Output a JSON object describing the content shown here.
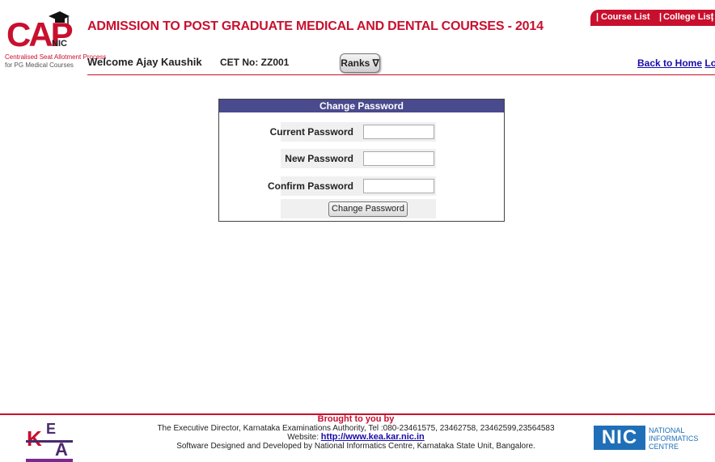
{
  "header": {
    "logo_text": "CAP",
    "logo_sub": "NIC",
    "logo_tagline_1": "Centralised Seat Allotment Process",
    "logo_tagline_2": "for PG Medical Courses",
    "title": "ADMISSION TO POST GRADUATE MEDICAL AND DENTAL COURSES - 2014",
    "top_links": {
      "course_list": "Course List",
      "college_list": "College List",
      "separator": "|"
    },
    "welcome": "Welcome Ajay Kaushik",
    "cet_no": "CET No: ZZ001",
    "ranks_button": "Ranks ∇",
    "back_home": "Back to Home",
    "logout": "Log Out"
  },
  "form": {
    "title": "Change Password",
    "current_label": "Current Password",
    "current_value": "",
    "new_label": "New Password",
    "new_value": "",
    "confirm_label": "Confirm Password",
    "confirm_value": "",
    "submit_label": "Change Password"
  },
  "footer": {
    "brought_by": "Brought to you by",
    "line1": "The Executive Director, Karnataka Examinations Authority, Tel :080-23461575, 23462758, 23462599,23564583",
    "website_label": "Website:",
    "website_url": "http://www.kea.kar.nic.in",
    "line3": "Software Designed and Developed by National Informatics Centre, Karnataka State Unit, Bangalore.",
    "kea_logo": "KEA",
    "nic_logo_mark": "NIC",
    "nic_line1": "NATIONAL",
    "nic_line2": "INFORMATICS",
    "nic_line3": "CENTRE"
  },
  "colors": {
    "brand_red": "#c8102e",
    "panel_header": "#4a4a8e",
    "link_blue": "#1a0dab"
  }
}
